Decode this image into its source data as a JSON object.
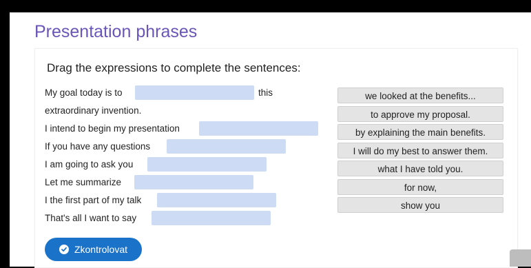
{
  "page": {
    "title": "Presentation phrases"
  },
  "exercise": {
    "instruction": "Drag the expressions to complete the sentences:",
    "sentences": [
      {
        "before": "My goal today is to",
        "after": "this"
      },
      {
        "before": "extraordinary invention.",
        "after": ""
      },
      {
        "before": "I intend to begin my presentation",
        "after": ""
      },
      {
        "before": "If you have any questions",
        "after": ""
      },
      {
        "before": "I am going to ask you",
        "after": ""
      },
      {
        "before": "Let me summarize",
        "after": ""
      },
      {
        "before": "I the first part of my talk",
        "after": ""
      },
      {
        "before": "That's all I want to say",
        "after": ""
      }
    ],
    "options": [
      "we looked at the benefits...",
      "to approve my proposal.",
      "by explaining the main benefits.",
      "I will do my best to answer them.",
      "what I have told you.",
      "for now,",
      "show you"
    ],
    "check_button_label": "Zkontrolovat",
    "check_icon": "check-circle-icon"
  }
}
